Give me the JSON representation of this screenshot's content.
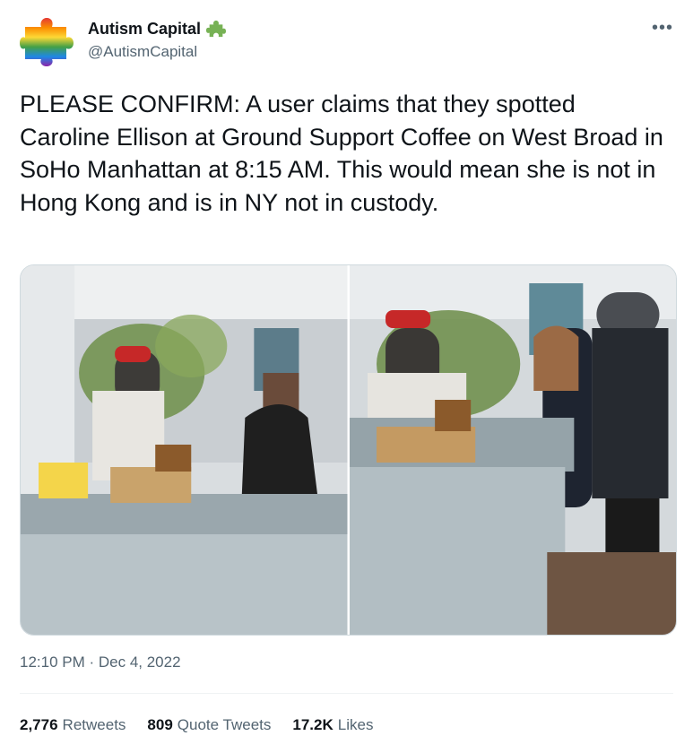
{
  "author": {
    "display_name": "Autism Capital",
    "handle": "@AutismCapital",
    "badge_icon": "puzzle-piece-icon",
    "badge_color": "#77b255"
  },
  "menu": {
    "icon": "more-options-icon",
    "glyph": "•••"
  },
  "tweet": {
    "text": "PLEASE CONFIRM: A user claims that they spotted Caroline Ellison at Ground Support Coffee on West Broad in SoHo Manhattan at 8:15 AM. This would mean she is not in Hong Kong and is in NY not in custody."
  },
  "media": {
    "photos": [
      {
        "name": "coffee-shop-photo-1"
      },
      {
        "name": "coffee-shop-photo-2"
      }
    ]
  },
  "timestamp": {
    "time": "12:10 PM",
    "separator": " · ",
    "date": "Dec 4, 2022"
  },
  "stats": {
    "retweets": {
      "count": "2,776",
      "label": "Retweets"
    },
    "quotes": {
      "count": "809",
      "label": "Quote Tweets"
    },
    "likes": {
      "count": "17.2K",
      "label": "Likes"
    }
  },
  "colors": {
    "text": "#0f1419",
    "secondary": "#536471",
    "border": "#eff3f4"
  }
}
